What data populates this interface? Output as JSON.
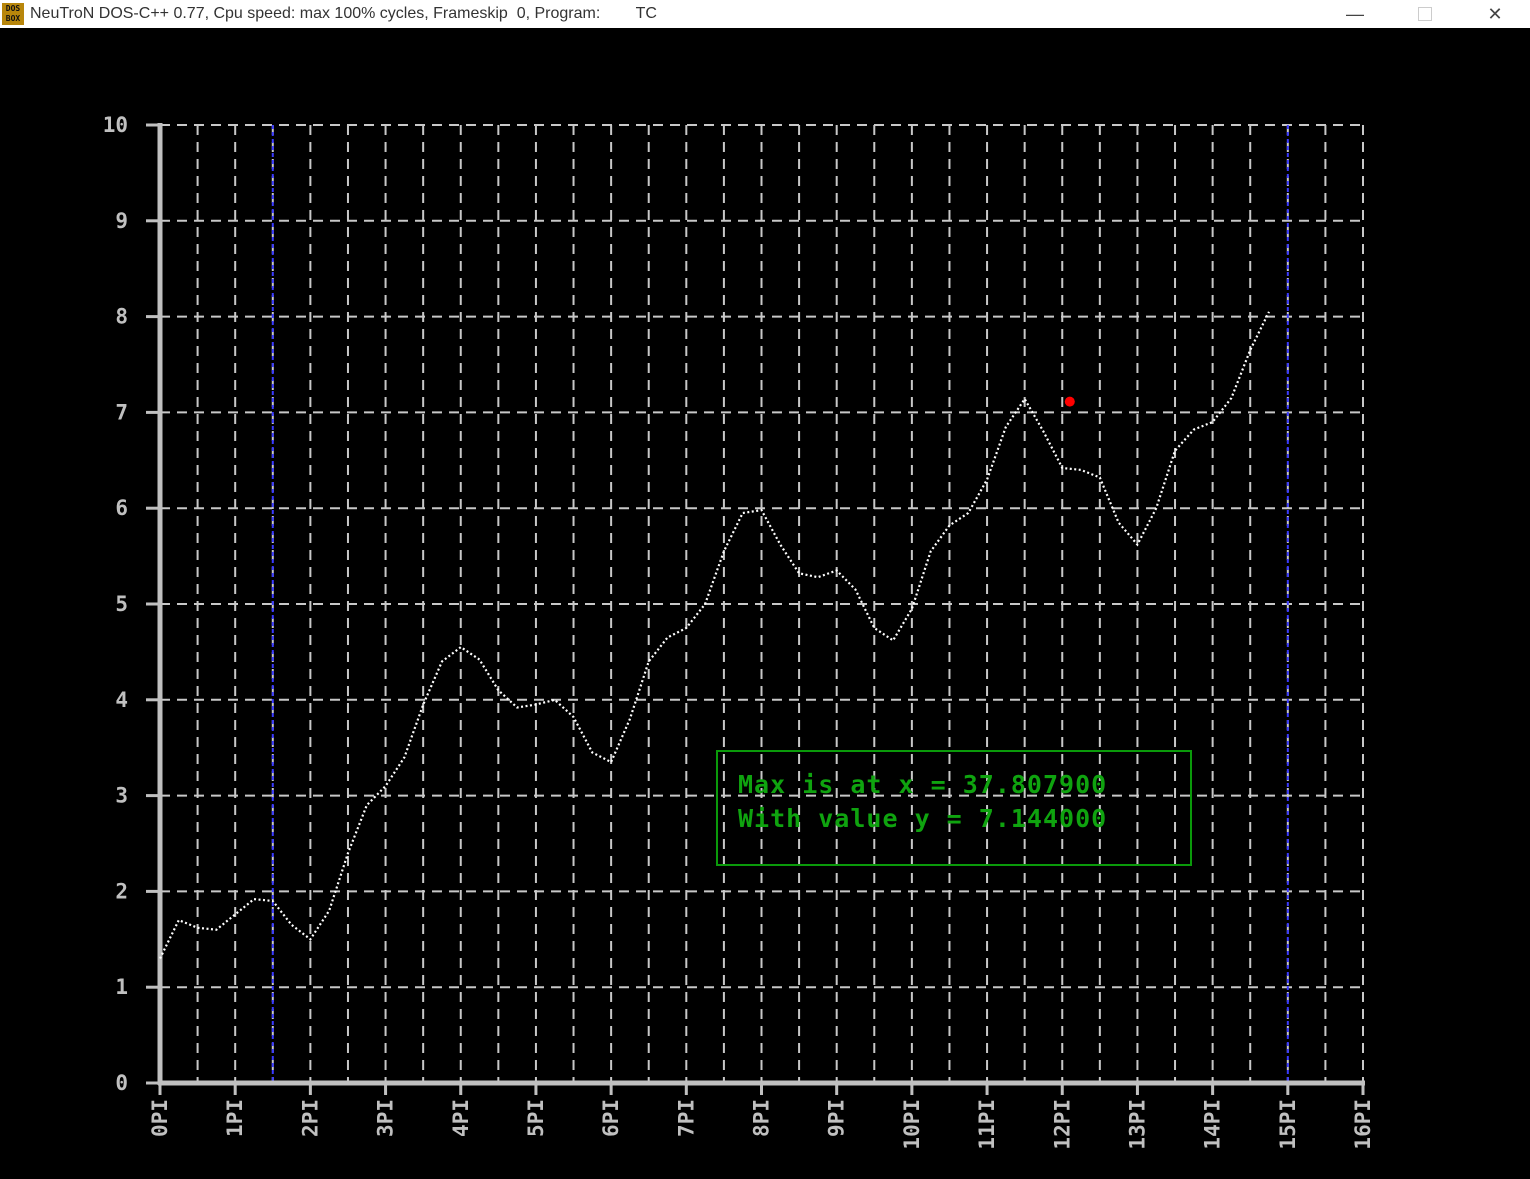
{
  "window": {
    "icon_text_top": "DOS",
    "icon_text_bottom": "BOX",
    "title": "NeuTroN DOS-C++ 0.77, Cpu speed: max 100% cycles, Frameskip  0, Program:        TC",
    "minimize_glyph": "—",
    "close_glyph": "✕"
  },
  "colors": {
    "background": "#000000",
    "axis": "#c0c0c0",
    "grid": "#c8c8c8",
    "curve": "#ffffff",
    "marker": "#ff0000",
    "bound_lines": "#3a3aff",
    "info_text": "#0fa30f"
  },
  "chart_data": {
    "type": "line",
    "x_unit": "PI",
    "xlim": [
      0,
      16
    ],
    "ylim": [
      0,
      10
    ],
    "x_tick_labels": [
      "0PI",
      "1PI",
      "2PI",
      "3PI",
      "4PI",
      "5PI",
      "6PI",
      "7PI",
      "8PI",
      "9PI",
      "10PI",
      "11PI",
      "12PI",
      "13PI",
      "14PI",
      "15PI",
      "16PI"
    ],
    "y_tick_labels": [
      "0",
      "1",
      "2",
      "3",
      "4",
      "5",
      "6",
      "7",
      "8",
      "9",
      "10"
    ],
    "grid": true,
    "series": [
      {
        "style": "dotted",
        "points": [
          [
            0.0,
            1.3
          ],
          [
            0.25,
            1.7
          ],
          [
            0.5,
            1.62
          ],
          [
            0.75,
            1.6
          ],
          [
            1.0,
            1.76
          ],
          [
            1.25,
            1.92
          ],
          [
            1.5,
            1.9
          ],
          [
            1.75,
            1.65
          ],
          [
            2.0,
            1.5
          ],
          [
            2.25,
            1.8
          ],
          [
            2.5,
            2.4
          ],
          [
            2.75,
            2.9
          ],
          [
            3.0,
            3.1
          ],
          [
            3.25,
            3.4
          ],
          [
            3.5,
            3.95
          ],
          [
            3.75,
            4.4
          ],
          [
            4.0,
            4.55
          ],
          [
            4.25,
            4.42
          ],
          [
            4.5,
            4.1
          ],
          [
            4.75,
            3.92
          ],
          [
            5.0,
            3.95
          ],
          [
            5.25,
            4.0
          ],
          [
            5.5,
            3.82
          ],
          [
            5.75,
            3.45
          ],
          [
            6.0,
            3.35
          ],
          [
            6.25,
            3.8
          ],
          [
            6.5,
            4.4
          ],
          [
            6.75,
            4.65
          ],
          [
            7.0,
            4.75
          ],
          [
            7.25,
            5.0
          ],
          [
            7.5,
            5.55
          ],
          [
            7.75,
            5.95
          ],
          [
            8.0,
            5.98
          ],
          [
            8.25,
            5.62
          ],
          [
            8.5,
            5.32
          ],
          [
            8.75,
            5.28
          ],
          [
            9.0,
            5.35
          ],
          [
            9.25,
            5.15
          ],
          [
            9.5,
            4.75
          ],
          [
            9.75,
            4.62
          ],
          [
            10.0,
            4.95
          ],
          [
            10.25,
            5.55
          ],
          [
            10.5,
            5.82
          ],
          [
            10.75,
            5.95
          ],
          [
            11.0,
            6.3
          ],
          [
            11.25,
            6.85
          ],
          [
            11.5,
            7.14
          ],
          [
            11.75,
            6.8
          ],
          [
            12.0,
            6.42
          ],
          [
            12.25,
            6.4
          ],
          [
            12.5,
            6.32
          ],
          [
            12.75,
            5.85
          ],
          [
            13.0,
            5.62
          ],
          [
            13.25,
            6.0
          ],
          [
            13.5,
            6.6
          ],
          [
            13.75,
            6.82
          ],
          [
            14.0,
            6.9
          ],
          [
            14.25,
            7.15
          ],
          [
            14.5,
            7.65
          ],
          [
            14.75,
            8.05
          ]
        ]
      }
    ],
    "bounds_x": [
      1.5,
      15.0
    ],
    "max_point": {
      "x": 12.034,
      "y": 7.144
    },
    "annotation": {
      "line1": "Max is at x = 37.807900",
      "line2": "With value y = 7.144000"
    }
  }
}
